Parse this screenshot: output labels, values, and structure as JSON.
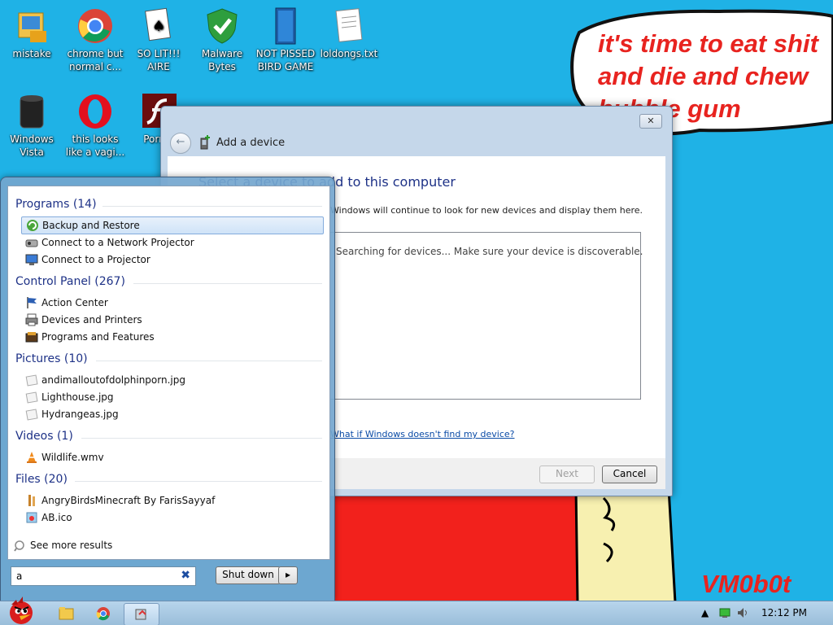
{
  "desktop": {
    "icons": [
      {
        "label": "mistake",
        "icon": "computer-folder-icon"
      },
      {
        "label": "chrome but normal c...",
        "icon": "chrome-icon"
      },
      {
        "label": "SO LIT!!! AIRE",
        "icon": "solitaire-cards-icon"
      },
      {
        "label": "Malware Bytes",
        "icon": "shield-check-icon"
      },
      {
        "label": "NOT PISSED BIRD GAME",
        "icon": "game-icon"
      },
      {
        "label": "loldongs.txt",
        "icon": "text-file-icon"
      },
      {
        "label": "Windows Vista",
        "icon": "trash-bin-icon"
      },
      {
        "label": "this looks like a vagi...",
        "icon": "opera-icon"
      },
      {
        "label": "Porn P",
        "icon": "flash-icon"
      }
    ],
    "speech_bubble": "it's time to eat shit\nand die and chew\nbubble gum",
    "signature": "VM0b0t"
  },
  "add_device_window": {
    "title": "Add a device",
    "heading": "Select a device to add to this computer",
    "subtext": "Windows will continue to look for new devices and display them here.",
    "searching_text": "Searching for devices...  Make sure your device is discoverable.",
    "help_link": "What if Windows doesn't find my device?",
    "next_label": "Next",
    "cancel_label": "Cancel",
    "close_glyph": "✕"
  },
  "start_menu": {
    "groups": [
      {
        "title": "Programs (14)",
        "items": [
          {
            "label": "Backup and Restore",
            "icon": "backup-restore-icon",
            "selected": true
          },
          {
            "label": "Connect to a Network Projector",
            "icon": "network-projector-icon"
          },
          {
            "label": "Connect to a Projector",
            "icon": "projector-icon"
          }
        ]
      },
      {
        "title": "Control Panel (267)",
        "items": [
          {
            "label": "Action Center",
            "icon": "action-center-flag-icon"
          },
          {
            "label": "Devices and Printers",
            "icon": "printer-icon"
          },
          {
            "label": "Programs and Features",
            "icon": "programs-features-icon"
          }
        ]
      },
      {
        "title": "Pictures (10)",
        "items": [
          {
            "label": "andimalloutofdolphinporn.jpg",
            "icon": "image-file-icon"
          },
          {
            "label": "Lighthouse.jpg",
            "icon": "image-file-icon"
          },
          {
            "label": "Hydrangeas.jpg",
            "icon": "image-file-icon"
          }
        ]
      },
      {
        "title": "Videos (1)",
        "items": [
          {
            "label": "Wildlife.wmv",
            "icon": "vlc-cone-icon"
          }
        ]
      },
      {
        "title": "Files (20)",
        "items": [
          {
            "label": "AngryBirdsMinecraft By FarisSayyaf",
            "icon": "file-icon"
          },
          {
            "label": "AB.ico",
            "icon": "ico-file-icon"
          }
        ]
      }
    ],
    "see_more": "See more results",
    "search_value": "a",
    "shutdown_label": "Shut down"
  },
  "taskbar": {
    "clock": "12:12 PM",
    "start_icon": "angry-bird-start-icon",
    "pinned": [
      "explorer-folder-icon",
      "chrome-icon",
      "add-device-icon"
    ]
  }
}
